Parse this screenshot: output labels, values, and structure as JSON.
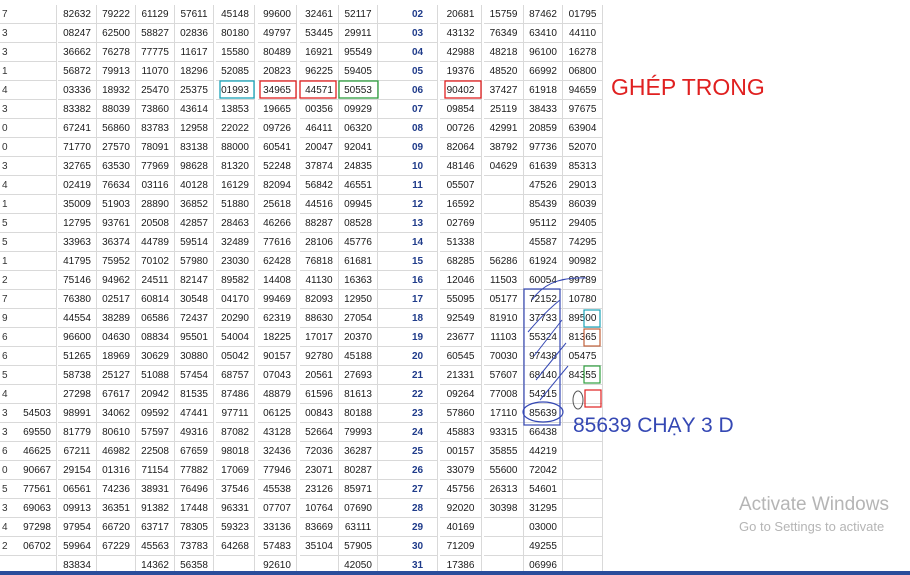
{
  "left_row_numbers": [
    "7",
    "3",
    "3",
    "1",
    "4",
    "3",
    "0",
    "0",
    "3",
    "4",
    "1",
    "5",
    "5",
    "1",
    "2",
    "7",
    "9",
    "6",
    "6",
    "5",
    "4",
    "3",
    "3",
    "6",
    "0",
    "5",
    "3",
    "4",
    "2",
    ""
  ],
  "left_rows": [
    [
      "",
      "82632",
      "79222",
      "61129",
      "57611",
      "45148",
      "99600",
      "32461",
      "52117"
    ],
    [
      "",
      "08247",
      "62500",
      "58827",
      "02836",
      "80180",
      "49797",
      "53445",
      "29911"
    ],
    [
      "",
      "36662",
      "76278",
      "77775",
      "11617",
      "15580",
      "80489",
      "16921",
      "95549"
    ],
    [
      "",
      "56872",
      "79913",
      "11070",
      "18296",
      "52085",
      "20823",
      "96225",
      "59405"
    ],
    [
      "",
      "03336",
      "18932",
      "25470",
      "25375",
      "01993",
      "34965",
      "44571",
      "50553"
    ],
    [
      "",
      "83382",
      "88039",
      "73860",
      "43614",
      "13853",
      "19665",
      "00356",
      "09929"
    ],
    [
      "",
      "67241",
      "56860",
      "83783",
      "12958",
      "22022",
      "09726",
      "46411",
      "06320"
    ],
    [
      "",
      "71770",
      "27570",
      "78091",
      "83138",
      "88000",
      "60541",
      "20047",
      "92041"
    ],
    [
      "",
      "32765",
      "63530",
      "77969",
      "98628",
      "81320",
      "52248",
      "37874",
      "24835"
    ],
    [
      "",
      "02419",
      "76634",
      "03116",
      "40128",
      "16129",
      "82094",
      "56842",
      "46551"
    ],
    [
      "",
      "35009",
      "51903",
      "28890",
      "36852",
      "51880",
      "25618",
      "44516",
      "09945"
    ],
    [
      "",
      "12795",
      "93761",
      "20508",
      "42857",
      "28463",
      "46266",
      "88287",
      "08528"
    ],
    [
      "",
      "33963",
      "36374",
      "44789",
      "59514",
      "32489",
      "77616",
      "28106",
      "45776"
    ],
    [
      "",
      "41795",
      "75952",
      "70102",
      "57980",
      "23030",
      "62428",
      "76818",
      "61681"
    ],
    [
      "",
      "75146",
      "94962",
      "24511",
      "82147",
      "89582",
      "14408",
      "41130",
      "16363"
    ],
    [
      "",
      "76380",
      "02517",
      "60814",
      "30548",
      "04170",
      "99469",
      "82093",
      "12950"
    ],
    [
      "",
      "44554",
      "38289",
      "06586",
      "72437",
      "20290",
      "62319",
      "88630",
      "27054"
    ],
    [
      "",
      "96600",
      "04630",
      "08834",
      "95501",
      "54004",
      "18225",
      "17017",
      "20370"
    ],
    [
      "",
      "51265",
      "18969",
      "30629",
      "30880",
      "05042",
      "90157",
      "92780",
      "45188"
    ],
    [
      "",
      "58738",
      "25127",
      "51088",
      "57454",
      "68757",
      "07043",
      "20561",
      "27693"
    ],
    [
      "",
      "27298",
      "67617",
      "20942",
      "81535",
      "87486",
      "48879",
      "61596",
      "81613"
    ],
    [
      "54503",
      "98991",
      "34062",
      "09592",
      "47441",
      "97711",
      "06125",
      "00843",
      "80188"
    ],
    [
      "69550",
      "81779",
      "80610",
      "57597",
      "49316",
      "87082",
      "43128",
      "52664",
      "79993"
    ],
    [
      "46625",
      "67211",
      "46982",
      "22508",
      "67659",
      "98018",
      "32436",
      "72036",
      "36287"
    ],
    [
      "90667",
      "29154",
      "01316",
      "71154",
      "77882",
      "17069",
      "77946",
      "23071",
      "80287"
    ],
    [
      "77561",
      "06561",
      "74236",
      "38931",
      "76496",
      "37546",
      "45538",
      "23126",
      "85971"
    ],
    [
      "69063",
      "09913",
      "36351",
      "91382",
      "17448",
      "96331",
      "07707",
      "10764",
      "07690"
    ],
    [
      "97298",
      "97954",
      "66720",
      "63717",
      "78305",
      "59323",
      "33136",
      "83669",
      "63111"
    ],
    [
      "06702",
      "59964",
      "67229",
      "45563",
      "73783",
      "64268",
      "57483",
      "35104",
      "57905"
    ],
    [
      "",
      "83834",
      "",
      "14362",
      "56358",
      "",
      "92610",
      "",
      "42050"
    ]
  ],
  "right_rows": [
    [
      "02",
      "20681",
      "15759",
      "87462",
      "01795"
    ],
    [
      "03",
      "43132",
      "76349",
      "63410",
      "44110"
    ],
    [
      "04",
      "42988",
      "48218",
      "96100",
      "16278"
    ],
    [
      "05",
      "19376",
      "48520",
      "66992",
      "06800"
    ],
    [
      "06",
      "90402",
      "37427",
      "61918",
      "94659"
    ],
    [
      "07",
      "09854",
      "25119",
      "38433",
      "97675"
    ],
    [
      "08",
      "00726",
      "42991",
      "20859",
      "63904"
    ],
    [
      "09",
      "82064",
      "38792",
      "97736",
      "52070"
    ],
    [
      "10",
      "48146",
      "04629",
      "61639",
      "85313"
    ],
    [
      "11",
      "05507",
      "",
      "47526",
      "29013"
    ],
    [
      "12",
      "16592",
      "",
      "85439",
      "86039"
    ],
    [
      "13",
      "02769",
      "",
      "95112",
      "29405"
    ],
    [
      "14",
      "51338",
      "",
      "45587",
      "74295"
    ],
    [
      "15",
      "68285",
      "56286",
      "61924",
      "90982"
    ],
    [
      "16",
      "12046",
      "11503",
      "60054",
      "99789"
    ],
    [
      "17",
      "55095",
      "05177",
      "72152",
      "10780"
    ],
    [
      "18",
      "92549",
      "81910",
      "37733",
      "89500"
    ],
    [
      "19",
      "23677",
      "11103",
      "55324",
      "81365"
    ],
    [
      "20",
      "60545",
      "70030",
      "97438",
      "05475"
    ],
    [
      "21",
      "21331",
      "57607",
      "68140",
      "84355"
    ],
    [
      "22",
      "09264",
      "77008",
      "54315",
      ""
    ],
    [
      "23",
      "57860",
      "17110",
      "85639",
      ""
    ],
    [
      "24",
      "45883",
      "93315",
      "66438",
      ""
    ],
    [
      "25",
      "00157",
      "35855",
      "44219",
      ""
    ],
    [
      "26",
      "33079",
      "55600",
      "72042",
      ""
    ],
    [
      "27",
      "45756",
      "26313",
      "54601",
      ""
    ],
    [
      "28",
      "92020",
      "30398",
      "31295",
      ""
    ],
    [
      "29",
      "40169",
      "",
      "03000",
      ""
    ],
    [
      "30",
      "71209",
      "",
      "49255",
      ""
    ],
    [
      "31",
      "17386",
      "",
      "06996",
      ""
    ]
  ],
  "annotations": {
    "ghep_trong": "GHÉP TRONG",
    "chay_3d": "85639 CHẠY 3 D"
  },
  "watermark": {
    "line1": "Activate Windows",
    "line2": "Go to Settings to activate"
  },
  "colors": {
    "red_note": "#e02020",
    "blue_note": "#3548b4",
    "green_box": "#2e9e3e",
    "teal_box": "#1aa3b8",
    "day_text": "#1f3b8a"
  }
}
